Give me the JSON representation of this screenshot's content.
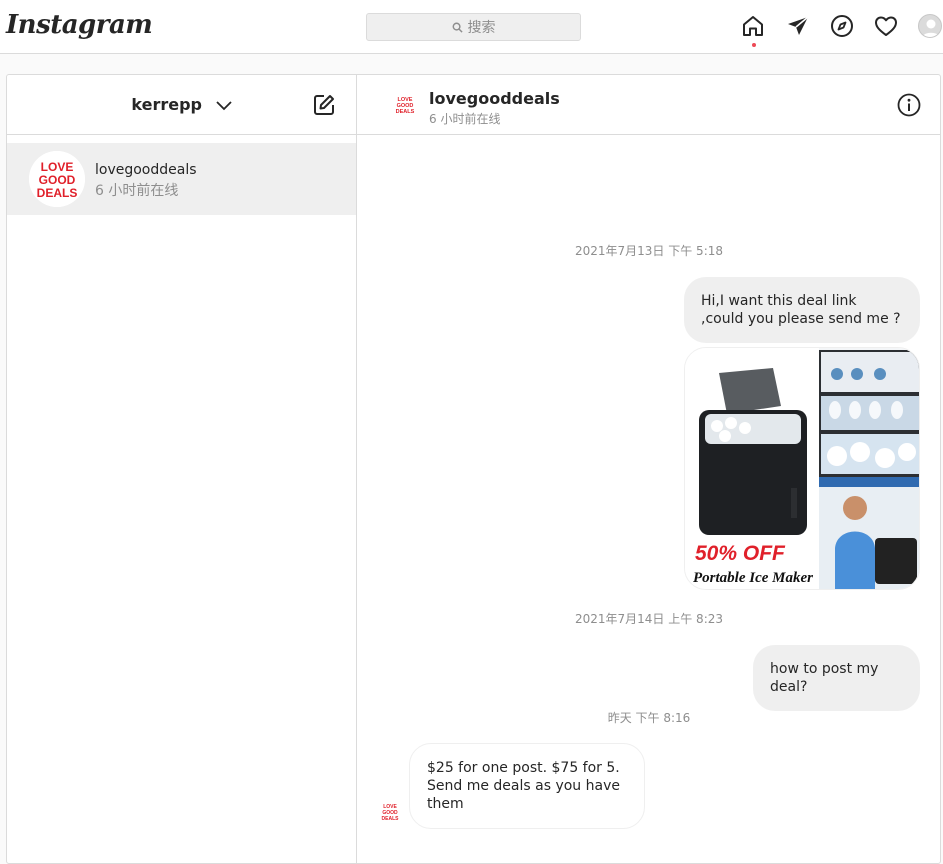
{
  "nav": {
    "logo": "Instagram",
    "search_placeholder": "搜索"
  },
  "inbox": {
    "account": "kerrepp",
    "threads": [
      {
        "name": "lovegooddeals",
        "status": "6 小时前在线"
      }
    ]
  },
  "chat": {
    "name": "lovegooddeals",
    "status": "6 小时前在线",
    "timestamps": [
      "2021年7月13日 下午 5:18",
      "2021年7月14日 上午 8:23",
      "昨天 下午 8:16"
    ],
    "messages": [
      {
        "from": "me",
        "text": "Hi,I want this deal link ,could you please send me ?"
      },
      {
        "from": "me",
        "image": true,
        "caption_top": "50% OFF",
        "caption_bottom": "Portable Ice Maker"
      },
      {
        "from": "me",
        "text": "how to post my deal?"
      },
      {
        "from": "them",
        "text": "$25 for one post. $75 for 5. Send me deals as you have them"
      }
    ]
  },
  "avatar_text": {
    "l1": "LOVE",
    "l2": "GOOD",
    "l3": "DEALS"
  },
  "colors": {
    "accent_red": "#e0202a",
    "notification_dot": "#ed4956",
    "bubble_grey": "#efefef"
  }
}
